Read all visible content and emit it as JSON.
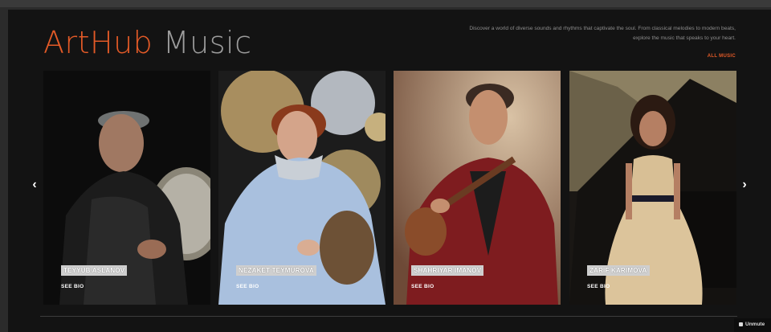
{
  "brand": {
    "name_part1": "ArtHub",
    "name_part2": " Music"
  },
  "tagline": {
    "line1": "Discover a world of diverse sounds and rhythms that captivate the soul. From classical melodies to modern beats,",
    "line2": "explore the music that speaks to your heart."
  },
  "all_music_label": "ALL MUSIC",
  "nav": {
    "prev_icon": "chevron-left-icon",
    "next_icon": "chevron-right-icon",
    "prev_glyph": "‹",
    "next_glyph": "›"
  },
  "artists": [
    {
      "name": "TEYYUB ASLANOV",
      "cta": "SEE BIO"
    },
    {
      "name": "NEZAKET TEYMUROVA",
      "cta": "SEE BIO"
    },
    {
      "name": "SHAHRIYAR IMANOV",
      "cta": "SEE BIO"
    },
    {
      "name": "ZARIF KARIMOVA",
      "cta": "SEE BIO"
    }
  ],
  "unmute_label": "Unmute",
  "colors": {
    "accent": "#e35a27",
    "background": "#131313",
    "text_muted": "#8d8d8d"
  }
}
